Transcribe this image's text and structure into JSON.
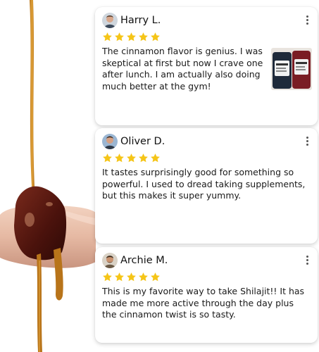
{
  "reviews": [
    {
      "name": "Harry L.",
      "rating": 5,
      "text": "The cinnamon flavor is genius. I was skeptical at first but now I crave one after lunch. I am actually also doing much better at the gym!",
      "has_photo": true
    },
    {
      "name": "Oliver D.",
      "rating": 5,
      "text": "It tastes surprisingly good for something so powerful. I used to dread taking supplements, but this makes it super yummy.",
      "has_photo": false
    },
    {
      "name": "Archie M.",
      "rating": 5,
      "text": "This is my favorite way to take Shilajit!! It has made me more active through the day plus the cinnamon twist is so tasty.",
      "has_photo": false
    }
  ],
  "colors": {
    "star": "#f5c518",
    "honey": "#c9881b",
    "resin": "#5a1a12",
    "card_bg": "#ffffff"
  },
  "icons": {
    "rating": "star-icon",
    "menu": "more-vertical-icon"
  }
}
